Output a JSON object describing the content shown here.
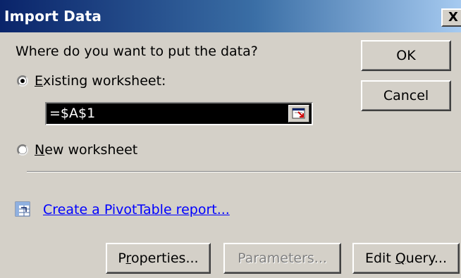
{
  "dialog": {
    "title": "Import Data",
    "close_label": "X"
  },
  "prompt": "Where do you want to put the data?",
  "options": {
    "existing_worksheet": {
      "accel": "E",
      "rest": "xisting worksheet:",
      "selected": true
    },
    "new_worksheet": {
      "accel": "N",
      "rest": "ew worksheet",
      "selected": false
    }
  },
  "cell_reference": "=$A$1",
  "pivot_link": {
    "pre": "Create a ",
    "accel": "P",
    "rest": "ivotTable report..."
  },
  "buttons": {
    "ok": "OK",
    "cancel": "Cancel",
    "properties": {
      "pre": "P",
      "accel": "r",
      "rest": "operties..."
    },
    "parameters": "Parameters...",
    "edit_query": {
      "pre": "Edit ",
      "accel": "Q",
      "rest": "uery..."
    }
  },
  "colors": {
    "title_start": "#0a246a",
    "title_end": "#a6caf0",
    "dialog_bg": "#d4d0c8",
    "link": "#0000ff"
  },
  "icons": {
    "reference_collapse": "collapse-dialog-icon",
    "pivot": "pivot-table-icon"
  }
}
